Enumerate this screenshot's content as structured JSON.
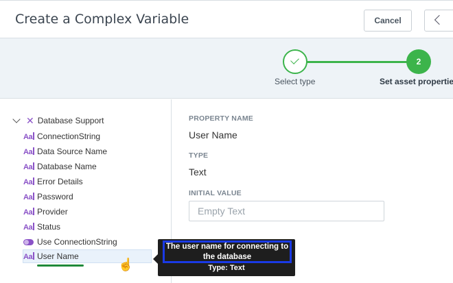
{
  "dialog": {
    "title": "Create a Complex Variable",
    "cancel_label": "Cancel"
  },
  "stepper": {
    "steps": [
      {
        "label": "Select type",
        "state": "done"
      },
      {
        "label": "Set asset properties",
        "number": "2",
        "state": "active"
      }
    ],
    "accent": "#3cb44b"
  },
  "tree": {
    "root": "Database Support",
    "items": [
      {
        "label": "ConnectionString",
        "icon": "text-type-icon"
      },
      {
        "label": "Data Source Name",
        "icon": "text-type-icon"
      },
      {
        "label": "Database Name",
        "icon": "text-type-icon"
      },
      {
        "label": "Error Details",
        "icon": "text-type-icon"
      },
      {
        "label": "Password",
        "icon": "text-type-icon"
      },
      {
        "label": "Provider",
        "icon": "text-type-icon"
      },
      {
        "label": "Status",
        "icon": "text-type-icon"
      },
      {
        "label": "Use ConnectionString",
        "icon": "boolean-toggle-icon"
      },
      {
        "label": "User Name",
        "icon": "text-type-icon",
        "selected": true
      }
    ],
    "icon_glyph": "Aa"
  },
  "properties": {
    "name_caption": "PROPERTY NAME",
    "name_value": "User Name",
    "type_caption": "TYPE",
    "type_value": "Text",
    "initial_caption": "INITIAL VALUE",
    "initial_placeholder": "Empty Text"
  },
  "tooltip": {
    "description": "The user name for connecting to the database",
    "type_line": "Type: Text"
  }
}
